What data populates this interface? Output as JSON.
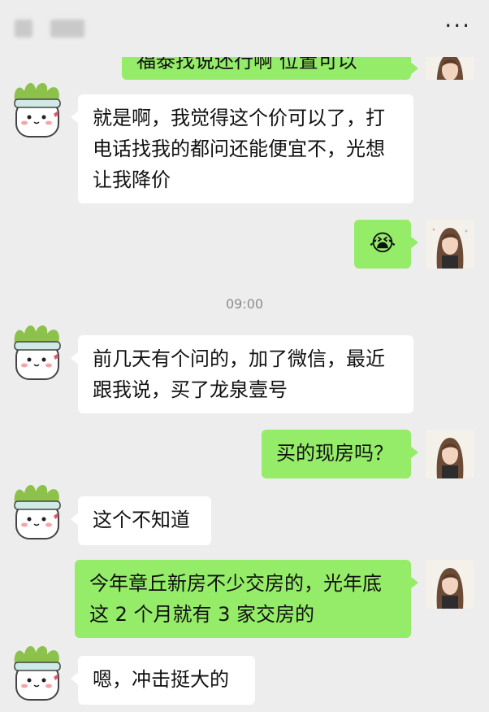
{
  "header": {
    "more_icon": "more-dots-icon"
  },
  "messages": [
    {
      "side": "right",
      "text": "福泰找说还行啊   位置可以"
    },
    {
      "side": "left",
      "text": "就是啊，我觉得这个价可以了，打电话找我的都问还能便宜不，光想让我降价"
    },
    {
      "side": "right",
      "emoji": "😭"
    },
    {
      "side": "center",
      "time": "09:00"
    },
    {
      "side": "left",
      "text": "前几天有个问的，加了微信，最近跟我说，买了龙泉壹号"
    },
    {
      "side": "right",
      "text": "买的现房吗？"
    },
    {
      "side": "left",
      "text": "这个不知道"
    },
    {
      "side": "right",
      "text": "今年章丘新房不少交房的，光年底这 2 个月就有 3 家交房的"
    },
    {
      "side": "left",
      "text": "嗯，冲击挺大的"
    }
  ],
  "colors": {
    "green_bubble": "#95ec69",
    "background": "#ededed",
    "white_bubble": "#ffffff"
  }
}
